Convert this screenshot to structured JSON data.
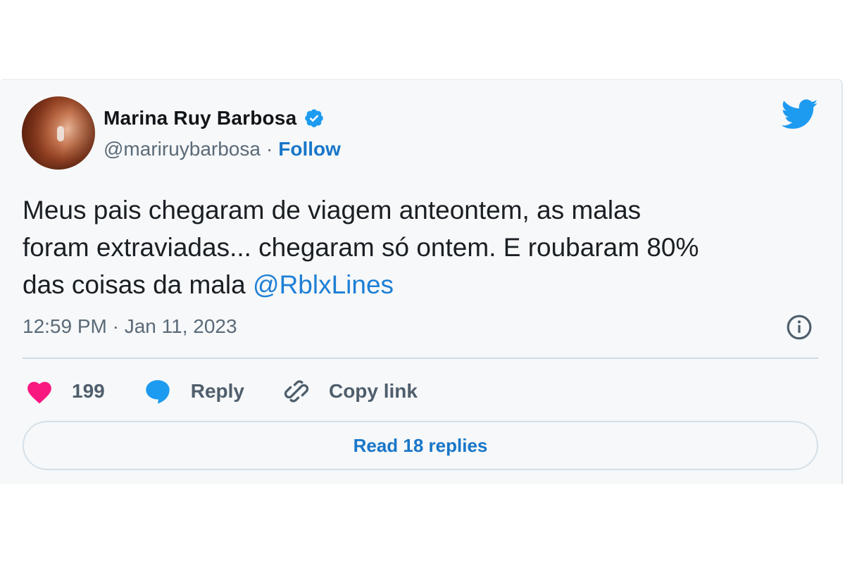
{
  "tweet": {
    "author": {
      "name": "Marina Ruy Barbosa",
      "handle": "@mariruybarbosa",
      "separator": "·",
      "follow_label": "Follow"
    },
    "text_plain": "Meus pais chegaram de viagem anteontem, as malas\nforam extraviadas... chegaram só ontem. E roubaram 80%\ndas coisas da mala ",
    "mention": "@RblxLines",
    "timestamp": "12:59 PM · Jan 11, 2023",
    "actions": {
      "likes_count": "199",
      "reply_label": "Reply",
      "copy_link_label": "Copy link"
    },
    "read_replies_label": "Read 18 replies"
  },
  "icons": {
    "verified": "verified-badge-icon",
    "brand": "twitter-bird-icon",
    "info": "info-icon",
    "like": "heart-icon",
    "reply": "speech-bubble-icon",
    "copy_link": "link-icon"
  },
  "colors": {
    "accent": "#1876c9",
    "twitter_blue": "#1d9bf0",
    "like_pink": "#f91880",
    "card_bg": "#f6f8f9"
  }
}
